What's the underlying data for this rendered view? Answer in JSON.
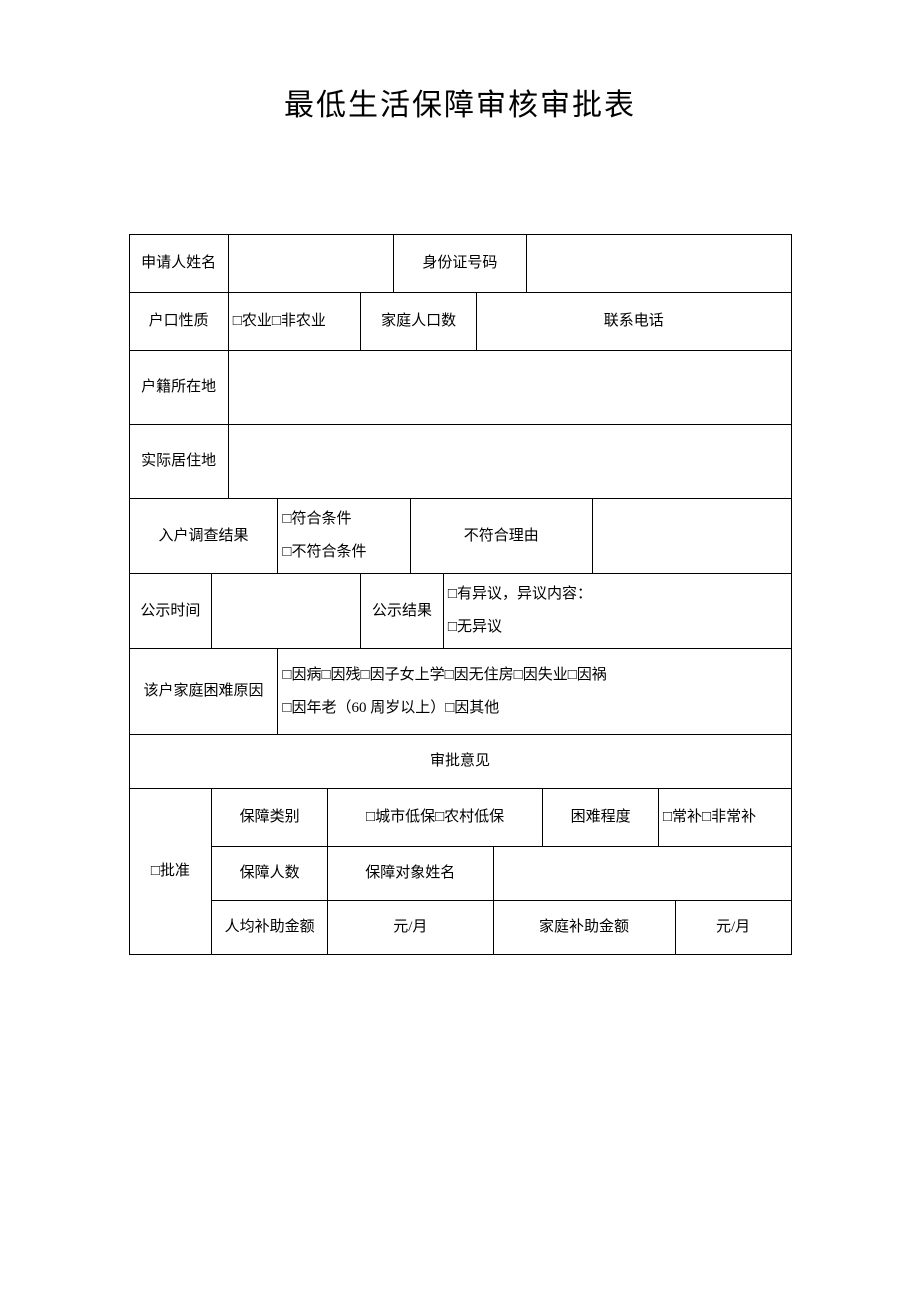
{
  "title": "最低生活保障审核审批表",
  "rows": {
    "applicant_name_label": "申请人姓名",
    "id_number_label": "身份证号码",
    "hukou_type_label": "户口性质",
    "hukou_type_value": "□农业□非农业",
    "family_size_label": "家庭人口数",
    "contact_phone_label": "联系电话",
    "hukou_location_label": "户籍所在地",
    "actual_residence_label": "实际居住地",
    "survey_result_label": "入户调查结果",
    "survey_result_value": "□符合条件\n□不符合条件",
    "noncompliance_reason_label": "不符合理由",
    "announcement_time_label": "公示时间",
    "announcement_result_label": "公示结果",
    "announcement_result_value": "□有异议，异议内容：\n□无异议",
    "difficulty_reason_label": "该户家庭困难原因",
    "difficulty_reason_value": "□因病□因残□因子女上学□因无住房□因失业□因祸\n□因年老（60 周岁以上）□因其他",
    "approval_opinion_header": "审批意见",
    "approved_label": "□批准",
    "guarantee_type_label": "保障类别",
    "guarantee_type_value": "□城市低保□农村低保",
    "difficulty_degree_label": "困难程度",
    "difficulty_degree_value": "□常补□非常补",
    "guarantee_count_label": "保障人数",
    "guarantee_names_label": "保障对象姓名",
    "per_capita_label": "人均补助金额",
    "unit_per_month": "元/月",
    "family_subsidy_label": "家庭补助金额"
  }
}
